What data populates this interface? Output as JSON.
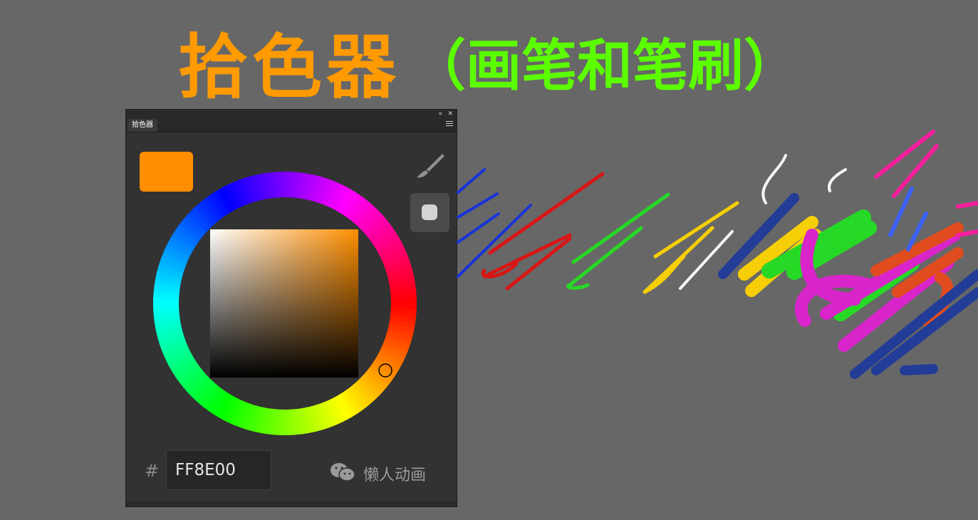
{
  "headline": {
    "title": "拾色器",
    "subtitle": "（画笔和笔刷）",
    "title_color": "#ff9a00",
    "subtitle_color": "#5cff00"
  },
  "panel": {
    "tab_label": "拾色器",
    "collapse_glyph": "«",
    "close_glyph": "✕",
    "current_color": "#ff8e00",
    "hash_symbol": "#",
    "hex_value": "FF8E00",
    "watermark": "懒人动画"
  },
  "icons": [
    "collapse-icon",
    "close-icon",
    "menu-icon",
    "brush-icon",
    "wechat-icon"
  ]
}
